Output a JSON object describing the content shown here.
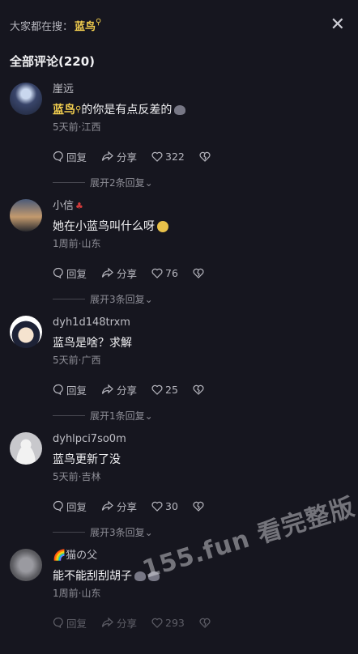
{
  "header": {
    "label": "大家都在搜：",
    "keyword": "蓝鸟",
    "close": "✕"
  },
  "count": "全部评论(220)",
  "comments": [
    {
      "user": "崖远",
      "text_prefix": "",
      "highlight": "蓝鸟",
      "text": "的你是有点反差的",
      "meta": "5天前·江西",
      "reply": "回复",
      "share": "分享",
      "likes": "322",
      "expand": "展开2条回复"
    },
    {
      "user": "小信",
      "text_prefix": "",
      "highlight": "",
      "text": "她在小蓝鸟叫什么呀",
      "meta": "1周前·山东",
      "reply": "回复",
      "share": "分享",
      "likes": "76",
      "expand": "展开3条回复"
    },
    {
      "user": "dyh1d148trxm",
      "text_prefix": "",
      "highlight": "",
      "text": "蓝鸟是啥？求解",
      "meta": "5天前·广西",
      "reply": "回复",
      "share": "分享",
      "likes": "25",
      "expand": "展开1条回复"
    },
    {
      "user": "dyhlpci7so0m",
      "text_prefix": "",
      "highlight": "",
      "text": "蓝鸟更新了没",
      "meta": "5天前·吉林",
      "reply": "回复",
      "share": "分享",
      "likes": "30",
      "expand": "展开3条回复"
    },
    {
      "user": "🌈猫の父",
      "text_prefix": "",
      "highlight": "",
      "text": "能不能刮刮胡子",
      "meta": "1周前·山东",
      "reply": "回复",
      "share": "分享",
      "likes": "293",
      "expand": ""
    }
  ],
  "watermark": "155.fun 看完整版",
  "colors": {
    "background": "#16161f",
    "keyword": "#f3cf4f",
    "muted": "#8d8d96"
  }
}
